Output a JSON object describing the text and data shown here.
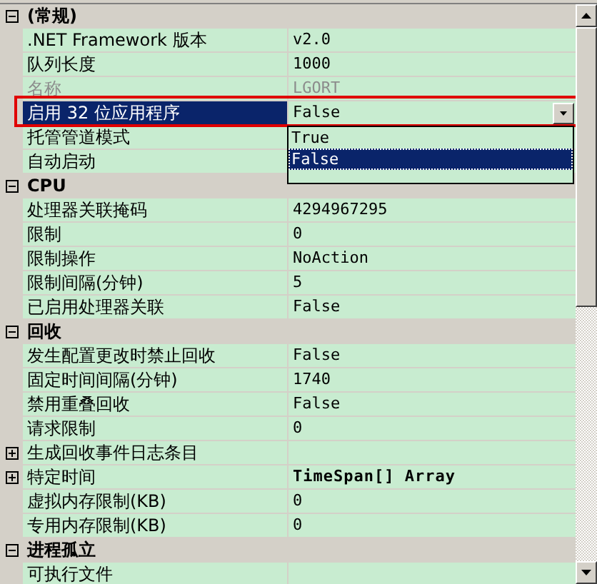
{
  "categories": [
    {
      "label": "(常规)",
      "expanded": true,
      "properties": [
        {
          "name": ".NET Framework 版本",
          "value": "v2.0",
          "kind": "plain",
          "selected": false,
          "disabled": false,
          "modified": false
        },
        {
          "name": "队列长度",
          "value": "1000",
          "kind": "plain",
          "selected": false,
          "disabled": false,
          "modified": false
        },
        {
          "name": "名称",
          "value": "LGORT",
          "kind": "plain",
          "selected": false,
          "disabled": true,
          "modified": false
        },
        {
          "name": "启用 32 位应用程序",
          "value": "False",
          "kind": "plain",
          "selected": true,
          "disabled": false,
          "modified": false,
          "dropdown": {
            "open": true,
            "options": [
              {
                "label": "True",
                "selected": false
              },
              {
                "label": "False",
                "selected": true
              }
            ]
          }
        },
        {
          "name": "托管管道模式",
          "kind": "plain",
          "selected": false,
          "disabled": false
        },
        {
          "name": "自动启动",
          "kind": "plain",
          "selected": false,
          "disabled": false
        }
      ]
    },
    {
      "label": "CPU",
      "expanded": true,
      "properties": [
        {
          "name": "处理器关联掩码",
          "value": "4294967295",
          "kind": "plain",
          "selected": false,
          "disabled": false,
          "modified": false
        },
        {
          "name": "限制",
          "value": "0",
          "kind": "plain",
          "selected": false,
          "disabled": false,
          "modified": false
        },
        {
          "name": "限制操作",
          "value": "NoAction",
          "kind": "plain",
          "selected": false,
          "disabled": false,
          "modified": false
        },
        {
          "name": "限制间隔(分钟)",
          "value": "5",
          "kind": "plain",
          "selected": false,
          "disabled": false,
          "modified": false
        },
        {
          "name": "已启用处理器关联",
          "value": "False",
          "kind": "plain",
          "selected": false,
          "disabled": false,
          "modified": false
        }
      ]
    },
    {
      "label": "回收",
      "expanded": true,
      "properties": [
        {
          "name": "发生配置更改时禁止回收",
          "value": "False",
          "kind": "plain",
          "selected": false,
          "disabled": false,
          "modified": false
        },
        {
          "name": "固定时间间隔(分钟)",
          "value": "1740",
          "kind": "plain",
          "selected": false,
          "disabled": false,
          "modified": false
        },
        {
          "name": "禁用重叠回收",
          "value": "False",
          "kind": "plain",
          "selected": false,
          "disabled": false,
          "modified": false
        },
        {
          "name": "请求限制",
          "value": "0",
          "kind": "plain",
          "selected": false,
          "disabled": false,
          "modified": false
        },
        {
          "name": "生成回收事件日志条目",
          "kind": "group",
          "expanded": false,
          "selected": false,
          "disabled": false
        },
        {
          "name": "特定时间",
          "value": "TimeSpan[] Array",
          "kind": "group",
          "expanded": false,
          "selected": false,
          "disabled": false,
          "modified": true
        },
        {
          "name": "虚拟内存限制(KB)",
          "value": "0",
          "kind": "plain",
          "selected": false,
          "disabled": false,
          "modified": false
        },
        {
          "name": "专用内存限制(KB)",
          "value": "0",
          "kind": "plain",
          "selected": false,
          "disabled": false,
          "modified": false
        }
      ]
    },
    {
      "label": "进程孤立",
      "expanded": true,
      "properties": [
        {
          "name": "可执行文件",
          "kind": "plain",
          "selected": false,
          "disabled": false
        }
      ]
    }
  ]
}
